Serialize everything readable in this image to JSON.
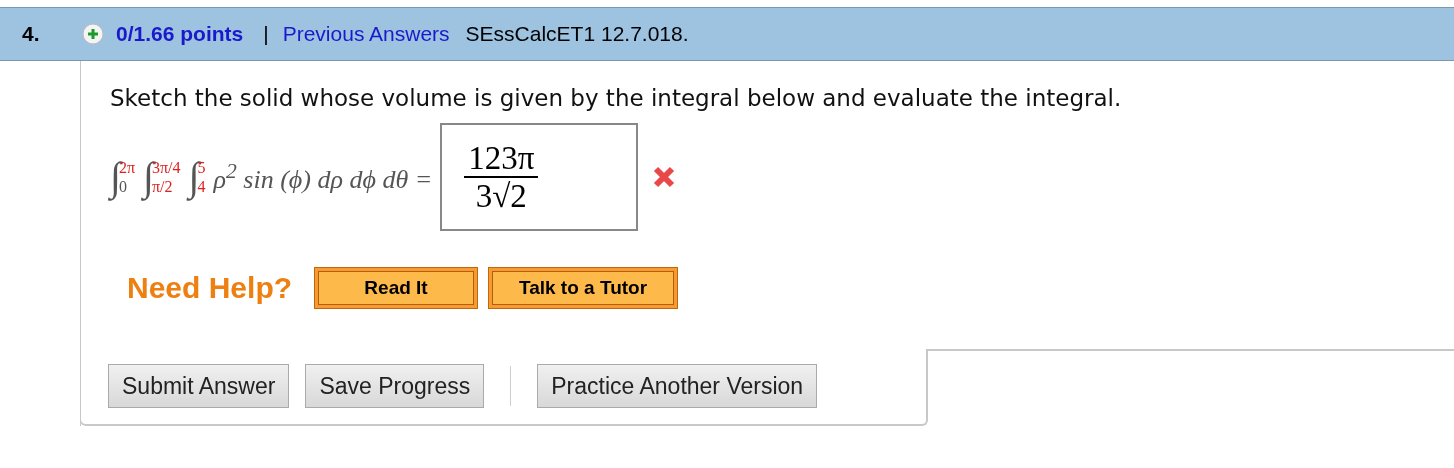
{
  "question": {
    "number": "4.",
    "points": "0/1.66 points",
    "separator": "|",
    "history_link": "Previous Answers",
    "source": "SEssCalcET1 12.7.018."
  },
  "prompt": "Sketch the solid whose volume is given by the integral below and evaluate the integral.",
  "integrals": [
    {
      "sign": "∫",
      "lower": "0",
      "upper": "2π",
      "lower_given": false,
      "upper_given": true
    },
    {
      "sign": "∫",
      "lower": "π/2",
      "upper": "3π/4",
      "lower_given": true,
      "upper_given": true
    },
    {
      "sign": "∫",
      "lower": "4",
      "upper": "5",
      "lower_given": true,
      "upper_given": true
    }
  ],
  "integrand": "ρ$^{2}$ sin (ϕ) dρ dϕ dθ =",
  "answer": {
    "numerator": "123π",
    "coefficient": "3",
    "radical": "√",
    "radicand": "2",
    "correct": false
  },
  "help": {
    "label": "Need Help?",
    "buttons": [
      "Read It",
      "Talk to a Tutor"
    ]
  },
  "action_groups": [
    {
      "buttons": [
        "Submit Answer",
        "Save Progress"
      ]
    },
    {
      "buttons": [
        "Practice Another Version"
      ]
    }
  ]
}
